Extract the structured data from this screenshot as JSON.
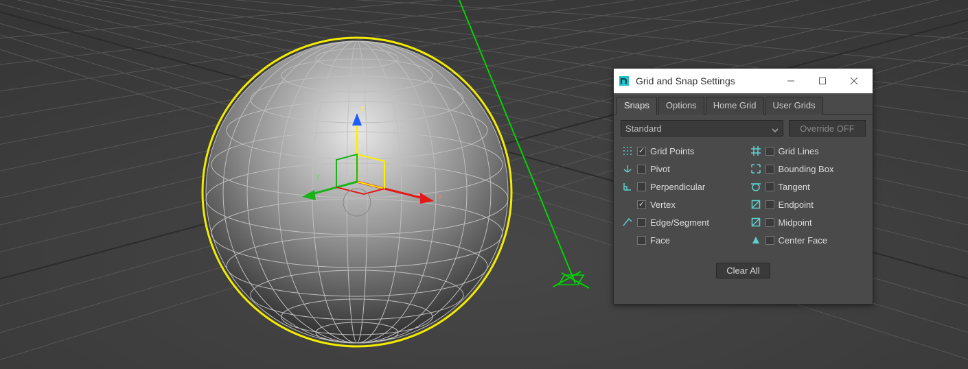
{
  "dialog": {
    "title": "Grid and Snap Settings",
    "tabs": [
      "Snaps",
      "Options",
      "Home Grid",
      "User Grids"
    ],
    "active_tab": 0,
    "dropdown_value": "Standard",
    "override_label": "Override OFF",
    "options_left": [
      {
        "label": "Grid Points",
        "checked": true
      },
      {
        "label": "Pivot",
        "checked": false
      },
      {
        "label": "Perpendicular",
        "checked": false
      },
      {
        "label": "Vertex",
        "checked": true
      },
      {
        "label": "Edge/Segment",
        "checked": false
      },
      {
        "label": "Face",
        "checked": false
      }
    ],
    "options_right": [
      {
        "label": "Grid Lines",
        "checked": false
      },
      {
        "label": "Bounding Box",
        "checked": false
      },
      {
        "label": "Tangent",
        "checked": false
      },
      {
        "label": "Endpoint",
        "checked": false
      },
      {
        "label": "Midpoint",
        "checked": false
      },
      {
        "label": "Center Face",
        "checked": false
      }
    ],
    "clear_label": "Clear All"
  },
  "gizmo": {
    "axis_x": "x",
    "axis_y": "y",
    "axis_z": "z"
  },
  "colors": {
    "grid_light": "#555555",
    "grid_dark": "#3a3a3a",
    "selection": "#f2ec00",
    "axis_x": "#e11919",
    "axis_y": "#17b317",
    "axis_z": "#1e5cff",
    "z_label": "#ffee33",
    "helper_green": "#00d400",
    "wire": "#bfbfbf",
    "teal": "#5fd0d0"
  }
}
